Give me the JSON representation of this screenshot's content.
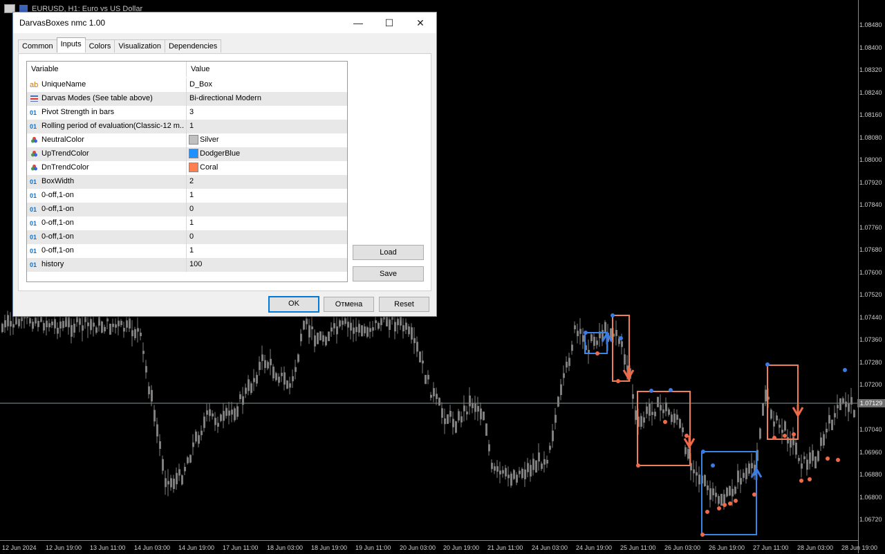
{
  "chart": {
    "title": "EURUSD, H1:  Euro vs US Dollar",
    "price_labels": [
      "1.08480",
      "1.08400",
      "1.08320",
      "1.08240",
      "1.08160",
      "1.08080",
      "1.08000",
      "1.07920",
      "1.07840",
      "1.07760",
      "1.07680",
      "1.07600",
      "1.07520",
      "1.07440",
      "1.07360",
      "1.07280",
      "1.07200",
      "1.07040",
      "1.06960",
      "1.06880",
      "1.06800",
      "1.06720"
    ],
    "current_price": "1.07129",
    "time_labels": [
      "12 Jun 2024",
      "12 Jun 19:00",
      "13 Jun 11:00",
      "14 Jun 03:00",
      "14 Jun 19:00",
      "17 Jun 11:00",
      "18 Jun 03:00",
      "18 Jun 19:00",
      "19 Jun 11:00",
      "20 Jun 03:00",
      "20 Jun 19:00",
      "21 Jun 11:00",
      "24 Jun 03:00",
      "24 Jun 19:00",
      "25 Jun 11:00",
      "26 Jun 03:00",
      "26 Jun 19:00",
      "27 Jun 11:00",
      "28 Jun 03:00",
      "28 Jun 19:00"
    ],
    "colors": {
      "up": "#3a7be8",
      "down": "#f06a4a",
      "box_up": "#3a86e8",
      "box_down": "#f0805a",
      "candle": "#7f7f7f"
    }
  },
  "dialog": {
    "title": "DarvasBoxes nmc 1.00",
    "minimize": "—",
    "maximize": "☐",
    "close": "✕",
    "tabs": [
      "Common",
      "Inputs",
      "Colors",
      "Visualization",
      "Dependencies"
    ],
    "active_tab": "Inputs",
    "table": {
      "col_variable": "Variable",
      "col_value": "Value",
      "rows": [
        {
          "icon": "ab",
          "name": "UniqueName",
          "value": "D_Box"
        },
        {
          "icon": "enum",
          "name": "Darvas Modes (See table above)",
          "value": "Bi-directional Modern"
        },
        {
          "icon": "01",
          "name": "Pivot Strength in bars",
          "value": "3"
        },
        {
          "icon": "01",
          "name": "Rolling period of evaluation(Classic-12 m...",
          "value": "1"
        },
        {
          "icon": "color",
          "name": "NeutralColor",
          "value": "Silver",
          "swatch": "#c0c0c0"
        },
        {
          "icon": "color",
          "name": "UpTrendColor",
          "value": "DodgerBlue",
          "swatch": "#1e90ff"
        },
        {
          "icon": "color",
          "name": "DnTrendColor",
          "value": "Coral",
          "swatch": "#ff7f50"
        },
        {
          "icon": "01",
          "name": "BoxWidth",
          "value": "2"
        },
        {
          "icon": "01",
          "name": "0-off,1-on",
          "value": "1"
        },
        {
          "icon": "01",
          "name": "0-off,1-on",
          "value": "0"
        },
        {
          "icon": "01",
          "name": "0-off,1-on",
          "value": "1"
        },
        {
          "icon": "01",
          "name": "0-off,1-on",
          "value": "0"
        },
        {
          "icon": "01",
          "name": "0-off,1-on",
          "value": "1"
        },
        {
          "icon": "01",
          "name": "history",
          "value": "100"
        }
      ]
    },
    "load_label": "Load",
    "save_label": "Save",
    "ok_label": "OK",
    "cancel_label": "Отмена",
    "reset_label": "Reset"
  }
}
